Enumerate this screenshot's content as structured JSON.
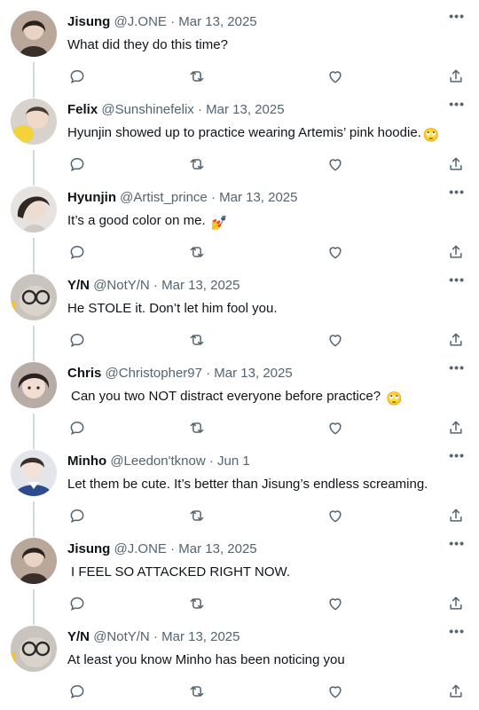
{
  "tweets": [
    {
      "name": "Jisung",
      "handle": "@J.ONE",
      "date": "· Mar 13, 2025",
      "text": "What did they do this time?",
      "emoji": ""
    },
    {
      "name": "Felix",
      "handle": "@Sunshinefelix",
      "date": "· Mar 13, 2025",
      "text": "Hyunjin showed up to practice wearing Artemis’ pink hoodie.",
      "emoji": "🙄"
    },
    {
      "name": "Hyunjin",
      "handle": "@Artist_prince",
      "date": "· Mar 13, 2025",
      "text": "It’s a good color on me.",
      "emoji": "💅"
    },
    {
      "name": "Y/N",
      "handle": "@NotY/N",
      "date": "· Mar 13, 2025",
      "text": "He STOLE it. Don’t let him fool you.",
      "emoji": ""
    },
    {
      "name": "Chris",
      "handle": "@Christopher97",
      "date": "· Mar 13, 2025",
      "text": "Can you two NOT distract everyone before practice?",
      "emoji": "🙄"
    },
    {
      "name": "Minho",
      "handle": "@Leedon'tknow",
      "date": "· Jun 1",
      "text": "Let them be cute. It’s better than Jisung’s endless screaming.",
      "emoji": ""
    },
    {
      "name": "Jisung",
      "handle": "@J.ONE",
      "date": "· Mar 13, 2025",
      "text": "I FEEL SO ATTACKED RIGHT NOW.",
      "emoji": ""
    },
    {
      "name": "Y/N",
      "handle": "@NotY/N",
      "date": "· Mar 13, 2025",
      "text": "At least you know Minho has been noticing you",
      "emoji": ""
    }
  ],
  "more_label": "•••",
  "icons": {
    "reply": "reply-icon",
    "retweet": "retweet-icon",
    "like": "heart-icon",
    "share": "share-icon",
    "more": "more-icon"
  },
  "colors": {
    "text": "#0f1419",
    "secondary": "#536471",
    "thread_line": "#cfd9de",
    "background": "#ffffff"
  }
}
